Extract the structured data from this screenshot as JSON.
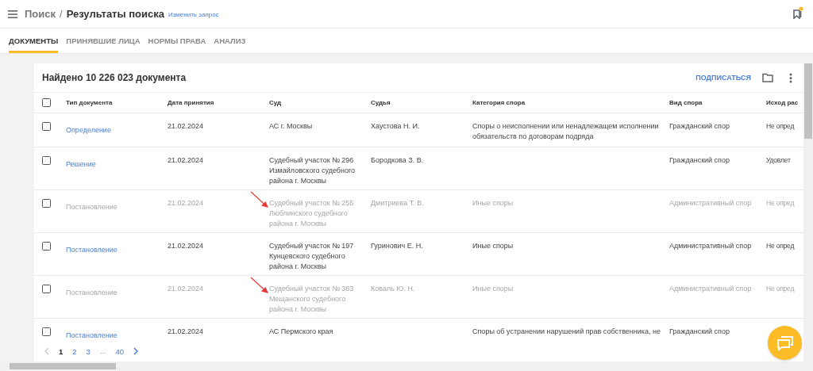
{
  "header": {
    "breadcrumb_root": "Поиск",
    "separator": "/",
    "title": "Результаты поиска",
    "edit_link": "Изменить запрос",
    "bookmarks_badge": true
  },
  "tabs": [
    {
      "label": "ДОКУМЕНТЫ",
      "selected": true
    },
    {
      "label": "ПРИНЯВШИЕ ЛИЦА",
      "selected": false
    },
    {
      "label": "НОРМЫ ПРАВА",
      "selected": false
    },
    {
      "label": "АНАЛИЗ",
      "selected": false
    }
  ],
  "results": {
    "title": "Найдено 10 226 023 документа",
    "subscribe": "ПОДПИСАТЬСЯ"
  },
  "table": {
    "select_all_checked": false,
    "columns": [
      "Тип документа",
      "Дата принятия",
      "Суд",
      "Судья",
      "Категория спора",
      "Вид спора",
      "Исход рас"
    ],
    "rows": [
      {
        "checked": false,
        "dimmed": false,
        "arrow": false,
        "type": "Определение",
        "date": "21.02.2024",
        "court": "АС г. Москвы",
        "judge": "Хаустова Н. И.",
        "category": "Споры о неисполнении или ненадлежащем исполнении обязательств по договорам подряда",
        "kind": "Гражданский спор",
        "outcome": "Не опред"
      },
      {
        "checked": false,
        "dimmed": false,
        "arrow": false,
        "type": "Решение",
        "date": "21.02.2024",
        "court": "Судебный участок № 296 Измайловского судебного района г. Москвы",
        "judge": "Бородкова З. В.",
        "kind": "Гражданский спор",
        "outcome": "Удовлет"
      },
      {
        "checked": false,
        "dimmed": true,
        "arrow": true,
        "type": "Постановление",
        "date": "21.02.2024",
        "court": "Судебный участок № 255 Люблинского судебного района г. Москвы",
        "judge": "Дмитриева Т. В.",
        "category": "Иные споры",
        "kind": "Административный спор",
        "outcome": "Не опред"
      },
      {
        "checked": false,
        "dimmed": false,
        "arrow": false,
        "type": "Постановление",
        "date": "21.02.2024",
        "court": "Судебный участок № 197 Кунцевского судебного района г. Москвы",
        "judge": "Гуринович Е. Н.",
        "category": "Иные споры",
        "kind": "Административный спор",
        "outcome": "Не опред"
      },
      {
        "checked": false,
        "dimmed": true,
        "arrow": true,
        "type": "Постановление",
        "date": "21.02.2024",
        "court": "Судебный участок № 383 Мещанского судебного района г. Москвы",
        "judge": "Коваль Ю. Н.",
        "category": "Иные споры",
        "kind": "Административный спор",
        "outcome": "Не опред"
      },
      {
        "checked": false,
        "dimmed": false,
        "arrow": false,
        "type": "Постановление",
        "date": "21.02.2024",
        "court": "АС Пермского края",
        "category": "Споры об устранении нарушений прав собственника, не",
        "kind": "Гражданский спор"
      }
    ]
  },
  "pagination": {
    "prev_disabled": true,
    "pages": [
      {
        "label": "1",
        "selected": true
      },
      {
        "label": "2",
        "selected": false
      },
      {
        "label": "3",
        "selected": false
      },
      {
        "label": "...",
        "kind": "gap"
      },
      {
        "label": "40",
        "selected": false
      }
    ]
  }
}
